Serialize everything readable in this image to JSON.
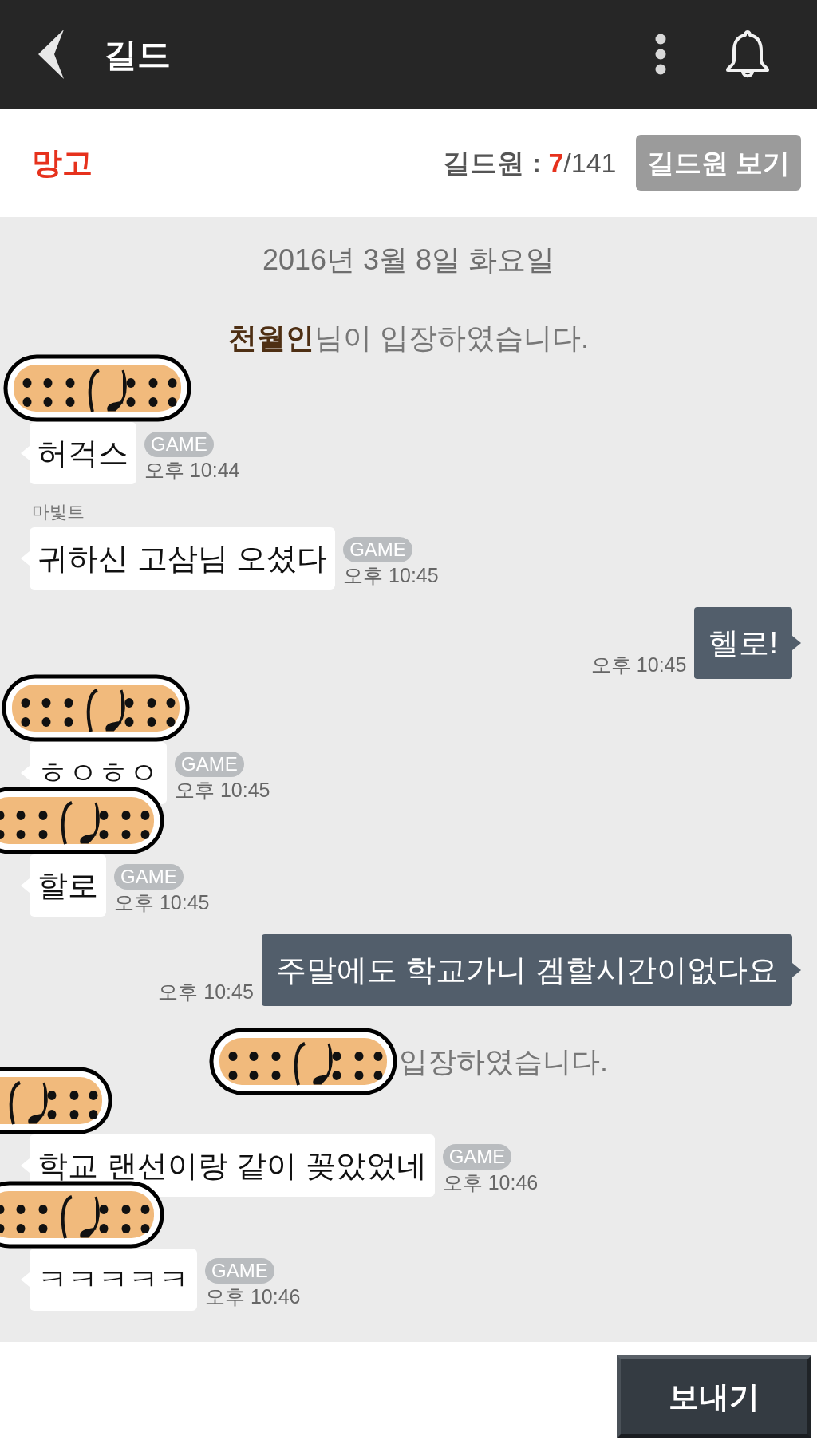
{
  "header": {
    "title": "길드"
  },
  "guild": {
    "name": "망고",
    "members_label": "길드원 :",
    "online": "7",
    "total": "/141",
    "members_button": "길드원 보기"
  },
  "messages": [
    {
      "kind": "date",
      "text": "2016년 3월 8일 화요일"
    },
    {
      "kind": "system",
      "name": "천월인",
      "text": "님이 입장하였습니다."
    },
    {
      "kind": "incoming",
      "sticker": true,
      "text": "허걱스",
      "tag": "GAME",
      "time": "오후 10:44"
    },
    {
      "kind": "incoming",
      "sender": "마빛트",
      "text": "귀하신 고삼님 오셨다",
      "tag": "GAME",
      "time": "오후 10:45"
    },
    {
      "kind": "outgoing",
      "text": "헬로!",
      "time": "오후 10:45"
    },
    {
      "kind": "incoming",
      "sticker": true,
      "text": "ㅎㅇㅎㅇ",
      "tag": "GAME",
      "time": "오후 10:45"
    },
    {
      "kind": "incoming",
      "sticker": true,
      "text": "할로",
      "tag": "GAME",
      "time": "오후 10:45"
    },
    {
      "kind": "outgoing",
      "text": "주말에도 학교가니 겜할시간이없다요",
      "time": "오후 10:45"
    },
    {
      "kind": "system",
      "sticker": true,
      "text": "입장하였습니다."
    },
    {
      "kind": "incoming",
      "sticker": true,
      "text": "학교 랜선이랑 같이 꽂았었네",
      "tag": "GAME",
      "time": "오후 10:46"
    },
    {
      "kind": "incoming",
      "sticker": true,
      "text": "ㅋㅋㅋㅋㅋ",
      "tag": "GAME",
      "time": "오후 10:46"
    }
  ],
  "composer": {
    "send_button": "보내기"
  }
}
